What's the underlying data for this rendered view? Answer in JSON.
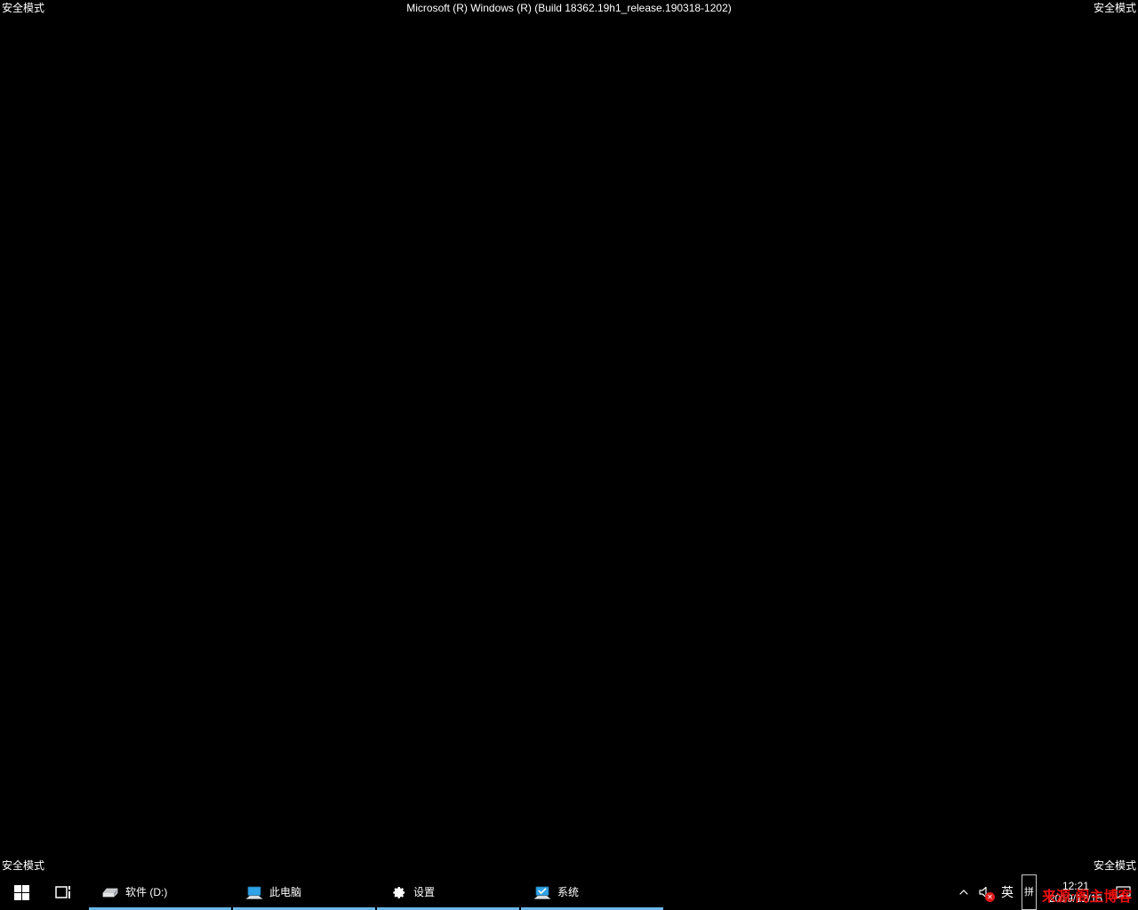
{
  "desktop": {
    "background_color": "#000000",
    "build_string": "Microsoft (R) Windows (R) (Build 18362.19h1_release.190318-1202)",
    "safe_mode_label": "安全模式"
  },
  "taskbar": {
    "background_color": "#000000",
    "active_underline_color": "#6db8e8",
    "start_button_label": "开始",
    "task_view_label": "任务视图",
    "windows": [
      {
        "label": "软件 (D:)",
        "icon": "hard-drive-icon",
        "active": true
      },
      {
        "label": "此电脑",
        "icon": "this-pc-icon",
        "active": true
      },
      {
        "label": "设置",
        "icon": "gear-icon",
        "active": true
      },
      {
        "label": "系统",
        "icon": "system-monitor-icon",
        "active": true
      }
    ]
  },
  "tray": {
    "chevron_label": "^",
    "volume_icon": "speaker-muted-icon",
    "volume_badge": "✕",
    "ime_language": "英",
    "ime_mode": "拼",
    "clock_time": "12:21",
    "clock_date": "2019/12/15",
    "action_center_label": "操作中心"
  },
  "watermark": {
    "text": "来源:阁主博客",
    "color": "#e81010"
  }
}
